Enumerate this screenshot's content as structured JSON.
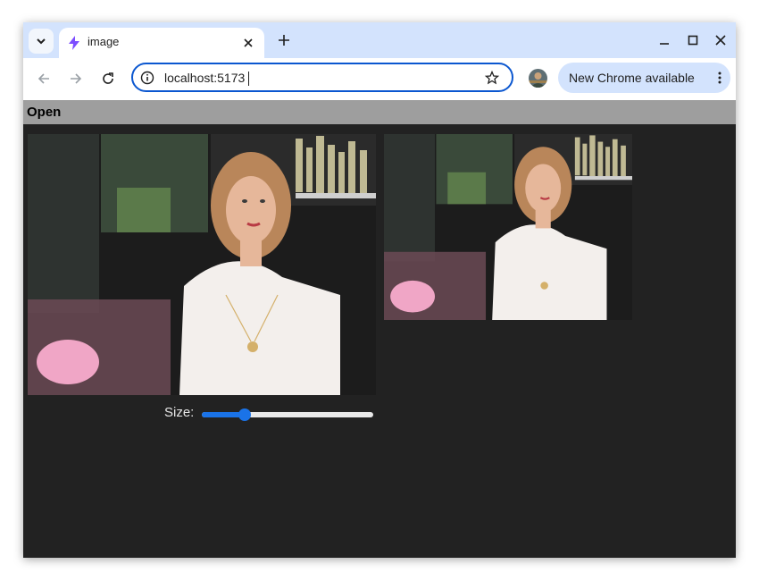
{
  "browser": {
    "tab": {
      "title": "image",
      "favicon": "bolt-icon"
    },
    "address": {
      "value": "localhost:5173"
    },
    "update_button": {
      "label": "New Chrome available"
    },
    "accent_color": "#0b57d0",
    "tabstrip_color": "#d3e3fd"
  },
  "app": {
    "menu": {
      "open_label": "Open"
    },
    "images": {
      "main": {
        "description": "photo"
      },
      "thumbnail": {
        "description": "photo"
      }
    },
    "size_control": {
      "label": "Size:",
      "value_fraction": 0.25
    },
    "colors": {
      "menubar": "#9e9e9e",
      "background": "#222222",
      "slider": "#1a73e8"
    }
  }
}
